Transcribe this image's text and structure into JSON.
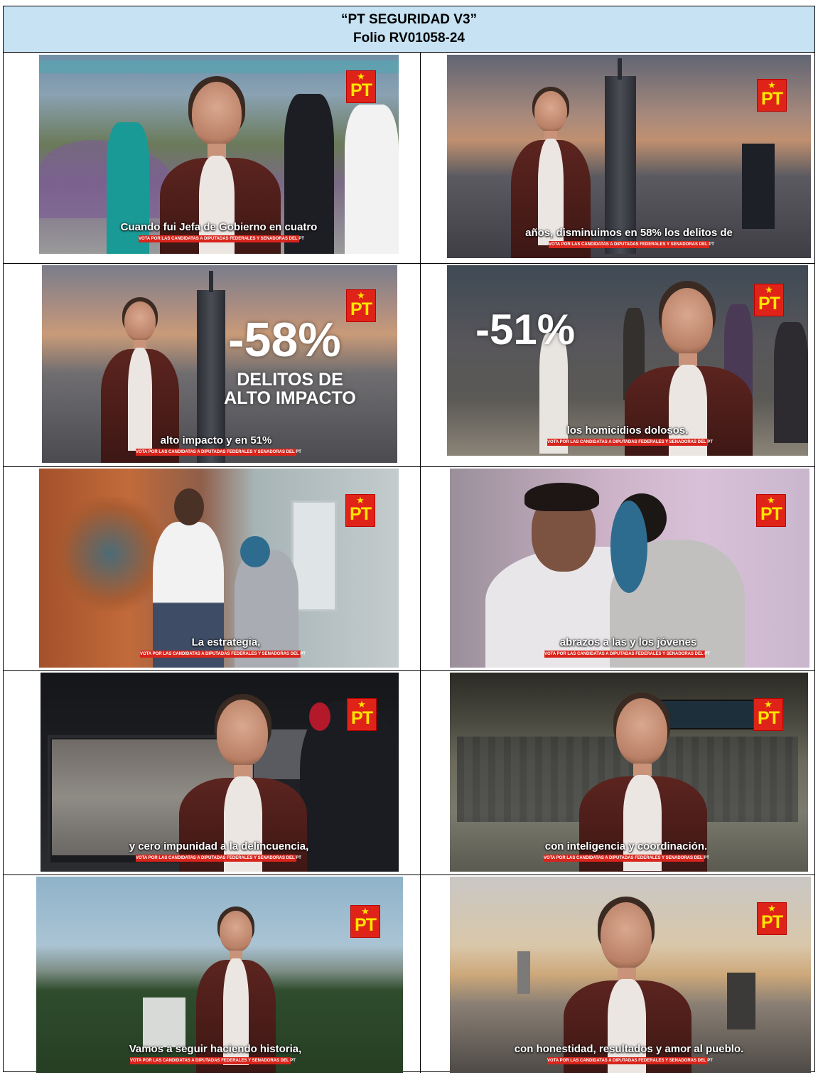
{
  "header": {
    "title": "“PT SEGURIDAD V3”",
    "folio": "Folio RV01058-24"
  },
  "logo": {
    "text": "PT",
    "star": "★"
  },
  "banner_text": "VOTA POR LAS CANDIDATAS A DIPUTADAS  FEDERALES Y SENADORAS DEL PT",
  "frames": [
    {
      "caption": "Cuando fui Jefa de Gobierno en cuatro"
    },
    {
      "caption": "años, disminuimos en 58% los delitos de"
    },
    {
      "caption": "alto impacto y en 51%",
      "overlay_value": "-58%",
      "overlay_line1": "DELITOS DE",
      "overlay_line2": "ALTO IMPACTO"
    },
    {
      "caption": "los homicidios dolosos.",
      "overlay_value": "-51%"
    },
    {
      "caption": "La estrategia,"
    },
    {
      "caption": "abrazos a las y los jóvenes"
    },
    {
      "caption": "y cero impunidad a la delincuencia,"
    },
    {
      "caption": "con inteligencia y coordinación."
    },
    {
      "caption": "Vamos a seguir haciendo historia,"
    },
    {
      "caption": "con honestidad, resultados y amor al pueblo."
    }
  ],
  "colors": {
    "header_bg": "#c6e2f3",
    "logo_red": "#e02318",
    "logo_yellow": "#ffe600",
    "banner_red": "#d8241b"
  }
}
